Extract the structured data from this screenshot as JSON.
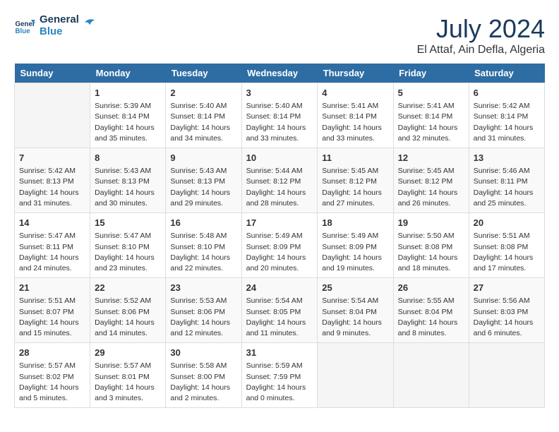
{
  "header": {
    "logo_line1": "General",
    "logo_line2": "Blue",
    "month_year": "July 2024",
    "location": "El Attaf, Ain Defla, Algeria"
  },
  "weekdays": [
    "Sunday",
    "Monday",
    "Tuesday",
    "Wednesday",
    "Thursday",
    "Friday",
    "Saturday"
  ],
  "weeks": [
    [
      {
        "day": "",
        "sunrise": "",
        "sunset": "",
        "daylight": ""
      },
      {
        "day": "1",
        "sunrise": "Sunrise: 5:39 AM",
        "sunset": "Sunset: 8:14 PM",
        "daylight": "Daylight: 14 hours and 35 minutes."
      },
      {
        "day": "2",
        "sunrise": "Sunrise: 5:40 AM",
        "sunset": "Sunset: 8:14 PM",
        "daylight": "Daylight: 14 hours and 34 minutes."
      },
      {
        "day": "3",
        "sunrise": "Sunrise: 5:40 AM",
        "sunset": "Sunset: 8:14 PM",
        "daylight": "Daylight: 14 hours and 33 minutes."
      },
      {
        "day": "4",
        "sunrise": "Sunrise: 5:41 AM",
        "sunset": "Sunset: 8:14 PM",
        "daylight": "Daylight: 14 hours and 33 minutes."
      },
      {
        "day": "5",
        "sunrise": "Sunrise: 5:41 AM",
        "sunset": "Sunset: 8:14 PM",
        "daylight": "Daylight: 14 hours and 32 minutes."
      },
      {
        "day": "6",
        "sunrise": "Sunrise: 5:42 AM",
        "sunset": "Sunset: 8:14 PM",
        "daylight": "Daylight: 14 hours and 31 minutes."
      }
    ],
    [
      {
        "day": "7",
        "sunrise": "Sunrise: 5:42 AM",
        "sunset": "Sunset: 8:13 PM",
        "daylight": "Daylight: 14 hours and 31 minutes."
      },
      {
        "day": "8",
        "sunrise": "Sunrise: 5:43 AM",
        "sunset": "Sunset: 8:13 PM",
        "daylight": "Daylight: 14 hours and 30 minutes."
      },
      {
        "day": "9",
        "sunrise": "Sunrise: 5:43 AM",
        "sunset": "Sunset: 8:13 PM",
        "daylight": "Daylight: 14 hours and 29 minutes."
      },
      {
        "day": "10",
        "sunrise": "Sunrise: 5:44 AM",
        "sunset": "Sunset: 8:12 PM",
        "daylight": "Daylight: 14 hours and 28 minutes."
      },
      {
        "day": "11",
        "sunrise": "Sunrise: 5:45 AM",
        "sunset": "Sunset: 8:12 PM",
        "daylight": "Daylight: 14 hours and 27 minutes."
      },
      {
        "day": "12",
        "sunrise": "Sunrise: 5:45 AM",
        "sunset": "Sunset: 8:12 PM",
        "daylight": "Daylight: 14 hours and 26 minutes."
      },
      {
        "day": "13",
        "sunrise": "Sunrise: 5:46 AM",
        "sunset": "Sunset: 8:11 PM",
        "daylight": "Daylight: 14 hours and 25 minutes."
      }
    ],
    [
      {
        "day": "14",
        "sunrise": "Sunrise: 5:47 AM",
        "sunset": "Sunset: 8:11 PM",
        "daylight": "Daylight: 14 hours and 24 minutes."
      },
      {
        "day": "15",
        "sunrise": "Sunrise: 5:47 AM",
        "sunset": "Sunset: 8:10 PM",
        "daylight": "Daylight: 14 hours and 23 minutes."
      },
      {
        "day": "16",
        "sunrise": "Sunrise: 5:48 AM",
        "sunset": "Sunset: 8:10 PM",
        "daylight": "Daylight: 14 hours and 22 minutes."
      },
      {
        "day": "17",
        "sunrise": "Sunrise: 5:49 AM",
        "sunset": "Sunset: 8:09 PM",
        "daylight": "Daylight: 14 hours and 20 minutes."
      },
      {
        "day": "18",
        "sunrise": "Sunrise: 5:49 AM",
        "sunset": "Sunset: 8:09 PM",
        "daylight": "Daylight: 14 hours and 19 minutes."
      },
      {
        "day": "19",
        "sunrise": "Sunrise: 5:50 AM",
        "sunset": "Sunset: 8:08 PM",
        "daylight": "Daylight: 14 hours and 18 minutes."
      },
      {
        "day": "20",
        "sunrise": "Sunrise: 5:51 AM",
        "sunset": "Sunset: 8:08 PM",
        "daylight": "Daylight: 14 hours and 17 minutes."
      }
    ],
    [
      {
        "day": "21",
        "sunrise": "Sunrise: 5:51 AM",
        "sunset": "Sunset: 8:07 PM",
        "daylight": "Daylight: 14 hours and 15 minutes."
      },
      {
        "day": "22",
        "sunrise": "Sunrise: 5:52 AM",
        "sunset": "Sunset: 8:06 PM",
        "daylight": "Daylight: 14 hours and 14 minutes."
      },
      {
        "day": "23",
        "sunrise": "Sunrise: 5:53 AM",
        "sunset": "Sunset: 8:06 PM",
        "daylight": "Daylight: 14 hours and 12 minutes."
      },
      {
        "day": "24",
        "sunrise": "Sunrise: 5:54 AM",
        "sunset": "Sunset: 8:05 PM",
        "daylight": "Daylight: 14 hours and 11 minutes."
      },
      {
        "day": "25",
        "sunrise": "Sunrise: 5:54 AM",
        "sunset": "Sunset: 8:04 PM",
        "daylight": "Daylight: 14 hours and 9 minutes."
      },
      {
        "day": "26",
        "sunrise": "Sunrise: 5:55 AM",
        "sunset": "Sunset: 8:04 PM",
        "daylight": "Daylight: 14 hours and 8 minutes."
      },
      {
        "day": "27",
        "sunrise": "Sunrise: 5:56 AM",
        "sunset": "Sunset: 8:03 PM",
        "daylight": "Daylight: 14 hours and 6 minutes."
      }
    ],
    [
      {
        "day": "28",
        "sunrise": "Sunrise: 5:57 AM",
        "sunset": "Sunset: 8:02 PM",
        "daylight": "Daylight: 14 hours and 5 minutes."
      },
      {
        "day": "29",
        "sunrise": "Sunrise: 5:57 AM",
        "sunset": "Sunset: 8:01 PM",
        "daylight": "Daylight: 14 hours and 3 minutes."
      },
      {
        "day": "30",
        "sunrise": "Sunrise: 5:58 AM",
        "sunset": "Sunset: 8:00 PM",
        "daylight": "Daylight: 14 hours and 2 minutes."
      },
      {
        "day": "31",
        "sunrise": "Sunrise: 5:59 AM",
        "sunset": "Sunset: 7:59 PM",
        "daylight": "Daylight: 14 hours and 0 minutes."
      },
      {
        "day": "",
        "sunrise": "",
        "sunset": "",
        "daylight": ""
      },
      {
        "day": "",
        "sunrise": "",
        "sunset": "",
        "daylight": ""
      },
      {
        "day": "",
        "sunrise": "",
        "sunset": "",
        "daylight": ""
      }
    ]
  ]
}
